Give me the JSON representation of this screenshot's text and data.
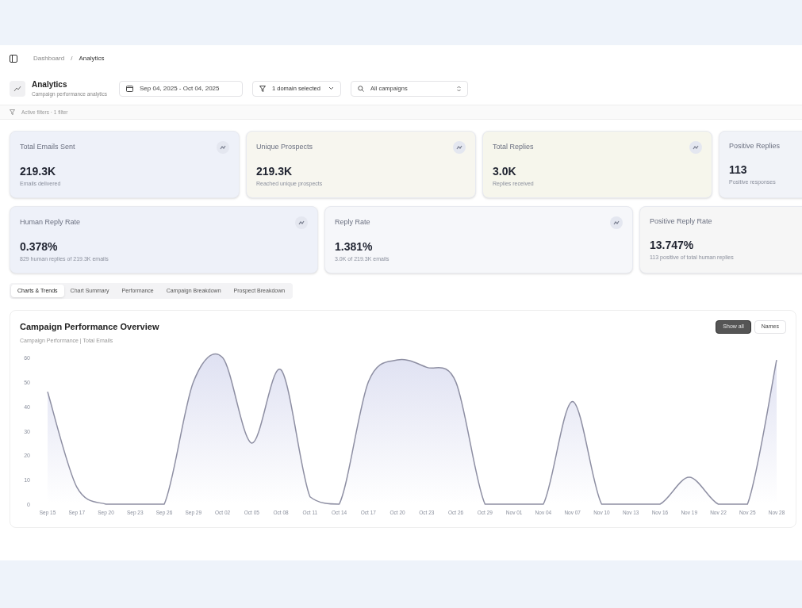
{
  "breadcrumb": [
    "Dashboard",
    "/",
    "Analytics"
  ],
  "header": {
    "title": "Analytics",
    "subtitle": "Campaign performance analytics",
    "date_range": "Sep 04, 2025 - Oct 04, 2025",
    "domain_filter": "1 domain selected",
    "campaign_search": {
      "placeholder": "All campaigns"
    }
  },
  "filters_bar": "Active filters · 1 filter",
  "stat_cards_top": [
    {
      "label": "Total Emails Sent",
      "value": "219.3K",
      "caption": "Emails delivered",
      "color": "#eef1f9"
    },
    {
      "label": "Unique Prospects",
      "value": "219.3K",
      "caption": "Reached unique prospects",
      "color": "#f7f6ef"
    },
    {
      "label": "Total Replies",
      "value": "3.0K",
      "caption": "Replies received",
      "color": "#f6f6ec"
    },
    {
      "label": "Positive Replies",
      "value": "113",
      "caption": "Positive responses",
      "color": "#f1f3f8"
    }
  ],
  "stat_cards_bottom": [
    {
      "label": "Human Reply Rate",
      "value": "0.378%",
      "caption": "829 human replies of 219.3K emails",
      "color": "#eef1f9"
    },
    {
      "label": "Reply Rate",
      "value": "1.381%",
      "caption": "3.0K of 219.3K emails",
      "color": "#f6f7fa"
    },
    {
      "label": "Positive Reply Rate",
      "value": "13.747%",
      "caption": "113 positive of total human replies",
      "color": "#f6f6f6"
    }
  ],
  "tabs": [
    {
      "label": "Charts & Trends",
      "selected": true
    },
    {
      "label": "Chart Summary",
      "selected": false
    },
    {
      "label": "Performance",
      "selected": false
    },
    {
      "label": "Campaign Breakdown",
      "selected": false
    },
    {
      "label": "Prospect Breakdown",
      "selected": false
    }
  ],
  "chart_panel": {
    "title": "Campaign Performance Overview",
    "subtitle": "Campaign Performance | Total Emails",
    "buttons": [
      {
        "label": "Show all",
        "selected": true
      },
      {
        "label": "Names",
        "selected": false
      }
    ],
    "chart_data": {
      "type": "area",
      "yticks": [
        0,
        10,
        20,
        30,
        40,
        50,
        60
      ],
      "ylim": [
        0,
        60
      ],
      "categories": [
        "Sep 15",
        "Sep 17",
        "Sep 20",
        "Sep 23",
        "Sep 26",
        "Sep 29",
        "Oct 02",
        "Oct 05",
        "Oct 08",
        "Oct 11",
        "Oct 14",
        "Oct 17",
        "Oct 20",
        "Oct 23",
        "Oct 26",
        "Oct 29",
        "Nov 01",
        "Nov 04",
        "Nov 07",
        "Nov 10",
        "Nov 13",
        "Nov 16",
        "Nov 19",
        "Nov 22",
        "Nov 25",
        "Nov 28"
      ],
      "series": [
        {
          "color": "#8e8fa3",
          "values": [
            46,
            7,
            0,
            0,
            0,
            50,
            60,
            25,
            55,
            3,
            0,
            50,
            59,
            56,
            50,
            0,
            0,
            0,
            42,
            0,
            0,
            0,
            11,
            0,
            0,
            59
          ]
        }
      ]
    }
  }
}
